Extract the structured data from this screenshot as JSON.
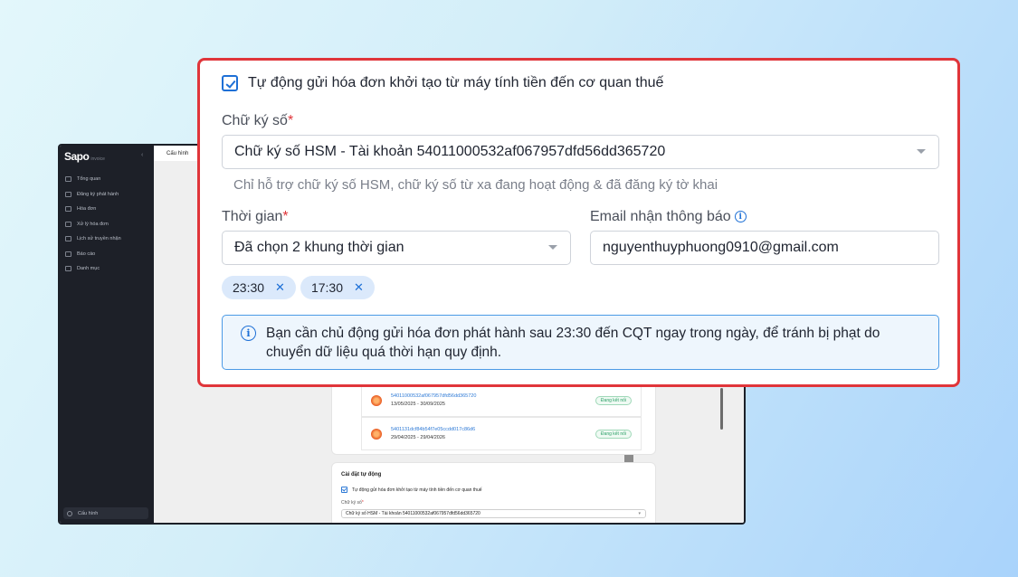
{
  "app": {
    "brand": "Sapo",
    "brand_sub": "invoice",
    "collapse_icon": "chevron-left-icon",
    "nav": [
      {
        "label": "Tổng quan",
        "icon": "home-icon"
      },
      {
        "label": "Đăng ký phát hành",
        "icon": "register-icon"
      },
      {
        "label": "Hóa đơn",
        "icon": "invoice-icon"
      },
      {
        "label": "Xử lý hóa đơn",
        "icon": "process-icon"
      },
      {
        "label": "Lịch sử truyền nhận",
        "icon": "transfer-icon"
      },
      {
        "label": "Báo cáo",
        "icon": "report-icon"
      },
      {
        "label": "Danh mục",
        "icon": "folder-icon"
      }
    ],
    "config_label": "Cấu hình",
    "tab_label": "Cấu hình",
    "signatures": [
      {
        "id": "54011000532af067957dfd56dd365720",
        "dates": "13/05/2025 - 30/09/2025",
        "status": "Đang kết nối"
      },
      {
        "id": "5401131dcf84b54f7e05ccdd017c86d6",
        "dates": "29/04/2025 - 29/04/2026",
        "status": "Đang kết nối"
      }
    ],
    "auto_section": {
      "title": "Cài đặt tự động",
      "checkbox_label": "Tự động gửi hóa đơn khởi tạo từ máy tính tiền đến cơ quan thuế",
      "sig_label": "Chữ ký số",
      "sig_required": "*",
      "sig_value": "Chữ ký số HSM - Tài khoản 54011000532af067957dfd56dd365720"
    }
  },
  "zoom": {
    "auto_send_label": "Tự động gửi hóa đơn khởi tạo từ máy tính tiền đến cơ quan thuế",
    "auto_send_checked": true,
    "signature_label": "Chữ ký số",
    "required_mark": "*",
    "signature_value": "Chữ ký số HSM - Tài khoản 54011000532af067957dfd56dd365720",
    "signature_hint": "Chỉ hỗ trợ chữ ký số HSM, chữ ký số từ xa đang hoạt động & đã đăng ký tờ khai",
    "time_label": "Thời gian",
    "time_value": "Đã chọn 2 khung thời gian",
    "email_label": "Email nhận thông báo",
    "email_value": "nguyenthuyphuong0910@gmail.com",
    "time_chips": [
      "23:30",
      "17:30"
    ],
    "chip_remove": "✕",
    "info_glyph": "i",
    "alert_text": "Bạn cần chủ động gửi hóa đơn phát hành sau 23:30 đến CQT ngay trong ngày, để tránh bị phạt do chuyển dữ liệu quá thời hạn quy định.",
    "colors": {
      "accent": "#1e70d6",
      "highlight_border": "#e0353a",
      "alert_bg": "#eef6fd"
    }
  }
}
